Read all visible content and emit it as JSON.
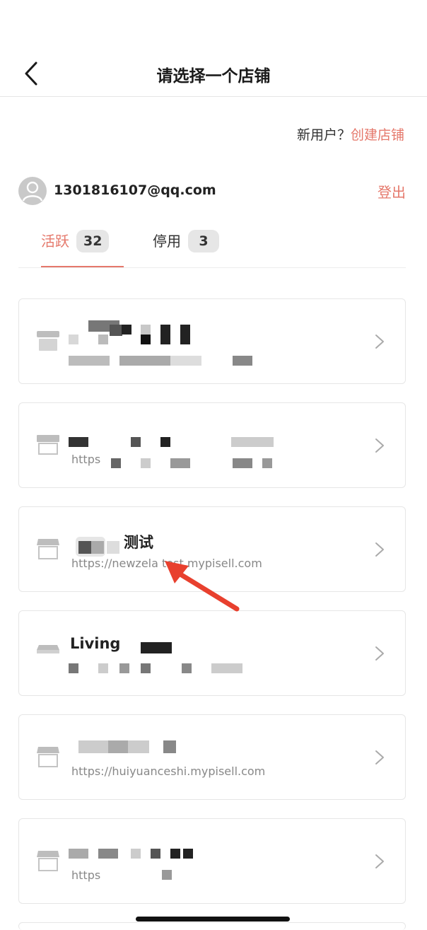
{
  "header": {
    "title": "请选择一个店铺",
    "back_icon": "chevron-left-icon"
  },
  "signup": {
    "prompt": "新用户？",
    "link": "创建店铺"
  },
  "account": {
    "email": "1301816107@qq.com",
    "logout": "登出",
    "avatar_icon": "user-icon"
  },
  "tabs": [
    {
      "label": "活跃",
      "count": "32",
      "active": true
    },
    {
      "label": "停用",
      "count": "3",
      "active": false
    }
  ],
  "stores": [
    {
      "name": "",
      "url": ""
    },
    {
      "name": "",
      "url": "https"
    },
    {
      "name": "测试",
      "url": "https://newzela    test.mypisell.com"
    },
    {
      "name": "Living",
      "url": ""
    },
    {
      "name": "",
      "url": "https://huiyuanceshi.mypisell.com"
    },
    {
      "name": "",
      "url": "https"
    }
  ],
  "colors": {
    "accent": "#e5786b",
    "annotation_arrow": "#e8402e"
  }
}
